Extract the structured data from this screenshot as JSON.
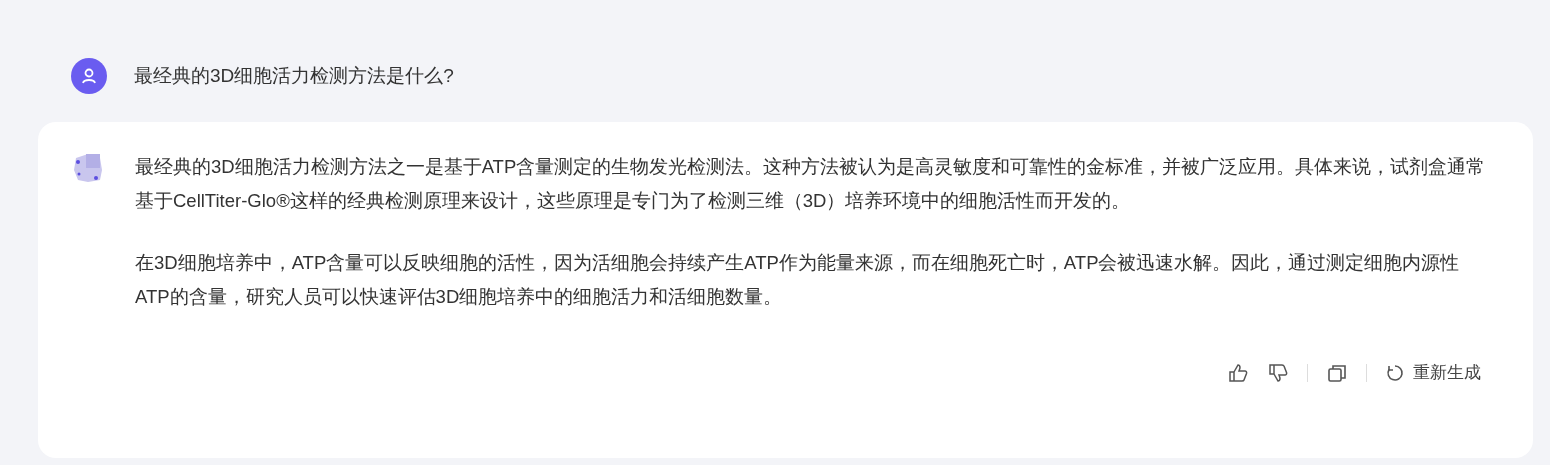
{
  "user_message": {
    "text": "最经典的3D细胞活力检测方法是什么?"
  },
  "reply": {
    "paragraphs": [
      "最经典的3D细胞活力检测方法之一是基于ATP含量测定的生物发光检测法。这种方法被认为是高灵敏度和可靠性的金标准，并被广泛应用。具体来说，试剂盒通常基于CellTiter-Glo®这样的经典检测原理来设计，这些原理是专门为了检测三维（3D）培养环境中的细胞活性而开发的。",
      "在3D细胞培养中，ATP含量可以反映细胞的活性，因为活细胞会持续产生ATP作为能量来源，而在细胞死亡时，ATP会被迅速水解。因此，通过测定细胞内源性ATP的含量，研究人员可以快速评估3D细胞培养中的细胞活力和活细胞数量。"
    ]
  },
  "actions": {
    "regenerate_label": "重新生成"
  }
}
